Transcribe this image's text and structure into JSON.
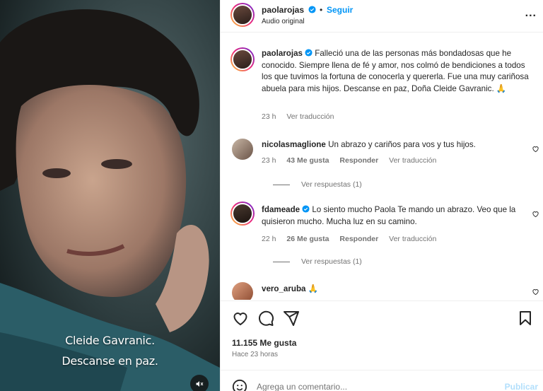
{
  "post": {
    "username": "paolarojas",
    "follow_label": "Seguir",
    "dot": "•",
    "audio": "Audio original",
    "more": "...",
    "caption_text": "Falleció una de las personas más bondadosas que he conocido. Siempre llena de fé y amor, nos colmó de bendiciones a todos los que tuvimos la fortuna de conocerla y quererla. Fue una muy cariñosa abuela para mis hijos. Descanse en paz, Doña Cleide Gavranic. 🙏",
    "caption_time": "23 h",
    "caption_translate": "Ver traducción"
  },
  "media": {
    "overlay_line1": "Cleide Gavranic.",
    "overlay_line2": "Descanse en paz."
  },
  "comments": [
    {
      "username": "nicolasmaglione",
      "text": "Un abrazo y cariños para vos y tus hijos.",
      "time": "23 h",
      "likes": "43 Me gusta",
      "reply": "Responder",
      "translate": "Ver traducción",
      "view_replies": "Ver respuestas (1)"
    },
    {
      "username": "fdameade",
      "text": "Lo siento mucho Paola Te mando un abrazo. Veo que la quisieron mucho. Mucha luz en su camino.",
      "time": "22 h",
      "likes": "26 Me gusta",
      "reply": "Responder",
      "translate": "Ver traducción",
      "view_replies": "Ver respuestas (1)"
    },
    {
      "username": "vero_aruba",
      "text": "🙏"
    }
  ],
  "actions": {
    "likes": "11.155 Me gusta",
    "posted": "Hace 23 horas"
  },
  "comment_box": {
    "placeholder": "Agrega un comentario...",
    "publish": "Publicar"
  },
  "colors": {
    "link": "#0095f6",
    "muted": "#737373",
    "verified": "#0095f6"
  }
}
